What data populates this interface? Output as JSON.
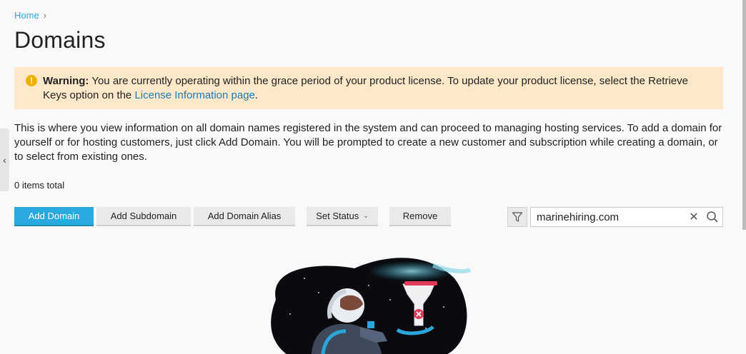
{
  "breadcrumb": {
    "home": "Home",
    "separator": "›"
  },
  "page": {
    "title": "Domains"
  },
  "warning": {
    "label": "Warning:",
    "text_before": " You are currently operating within the grace period of your product license. To update your product license, select the Retrieve Keys option on the ",
    "link": "License Information page",
    "text_after": "."
  },
  "intro": "This is where you view information on all domain names registered in the system and can proceed to managing hosting services. To add a domain for yourself or for hosting customers, just click Add Domain. You will be prompted to create a new customer and subscription while creating a domain, or to select from existing ones.",
  "list": {
    "count": "0 items total"
  },
  "toolbar": {
    "add_domain": "Add Domain",
    "add_subdomain": "Add Subdomain",
    "add_alias": "Add Domain Alias",
    "set_status": "Set Status",
    "remove": "Remove"
  },
  "search": {
    "value": "marinehiring.com"
  },
  "icons": {
    "warning": "warning-icon",
    "filter": "filter-icon",
    "clear": "close-icon",
    "search": "search-icon",
    "collapse": "chevron-left-icon"
  },
  "colors": {
    "primary": "#28aade",
    "warning_bg": "#fde8c9",
    "link": "#1b7bb5"
  }
}
